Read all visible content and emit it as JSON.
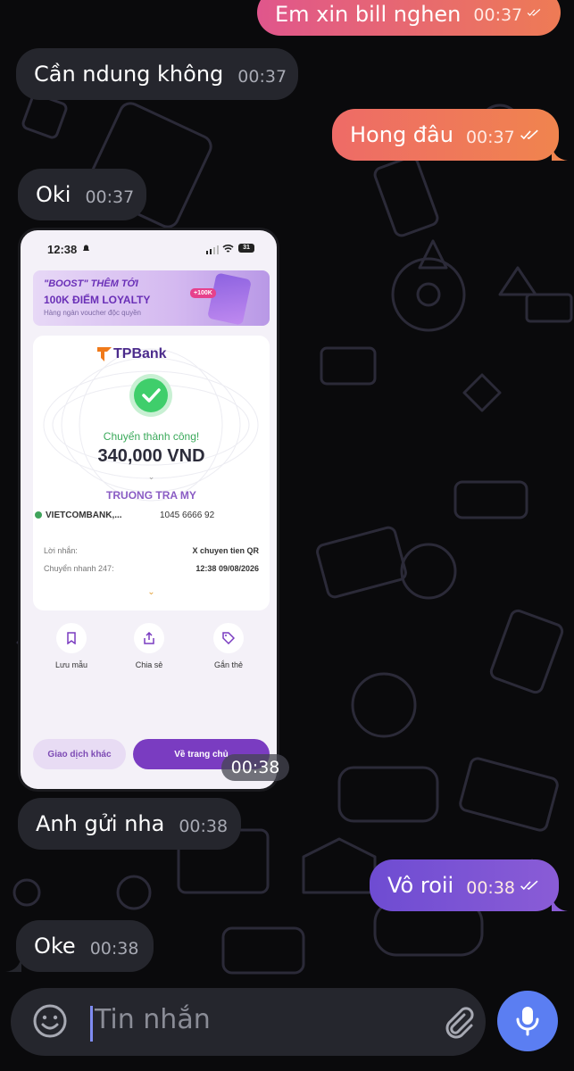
{
  "chat": {
    "messages": [
      {
        "text": "Em xin bill nghen",
        "time": "00:37",
        "direction": "outgoing",
        "read": true
      },
      {
        "text": "Cần ndung không",
        "time": "00:37",
        "direction": "incoming"
      },
      {
        "text": "Hong đâu",
        "time": "00:37",
        "direction": "outgoing",
        "read": true
      },
      {
        "text": "Oki",
        "time": "00:37",
        "direction": "incoming"
      },
      {
        "text": "Anh gửi nha",
        "time": "00:38",
        "direction": "incoming"
      },
      {
        "text": "Vô roii",
        "time": "00:38",
        "direction": "outgoing",
        "read": true
      },
      {
        "text": "Oke",
        "time": "00:38",
        "direction": "incoming"
      }
    ],
    "photo": {
      "time": "00:38",
      "screenshot": {
        "status_time": "12:38",
        "battery": "31",
        "banner": {
          "line1": "\"BOOST\" THÊM TỚI",
          "line2": "100K ĐIỂM LOYALTY",
          "line3": "Hàng ngàn voucher độc quyền",
          "badge": "+100K"
        },
        "bank_logo": "TPBank",
        "status": "Chuyển thành công!",
        "amount": "340,000 VND",
        "recipient_name": "TRUONG TRA MY",
        "recipient_bank": "VIETCOMBANK,...",
        "recipient_account": "1045 6666 92",
        "details": [
          {
            "label": "Lời nhắn:",
            "value": "X chuyen tien QR"
          },
          {
            "label": "Chuyển nhanh 247:",
            "value": "12:38 09/08/2026"
          }
        ],
        "actions": [
          {
            "label": "Lưu mẫu",
            "icon": "bookmark-icon"
          },
          {
            "label": "Chia sẻ",
            "icon": "share-icon"
          },
          {
            "label": "Gắn thẻ",
            "icon": "tag-icon"
          }
        ],
        "buttons": {
          "other": "Giao dịch khác",
          "home": "Về trang chủ"
        }
      }
    }
  },
  "composer": {
    "placeholder": "Tin nhắn"
  },
  "colors": {
    "background": "#0a0a0c",
    "incoming_bubble": "#25262d",
    "outgoing_gradient_start": "#e0568c",
    "outgoing_gradient_end": "#f0844e",
    "outgoing_purple": "#6e4cd2",
    "mic_button": "#5b7ef2"
  }
}
